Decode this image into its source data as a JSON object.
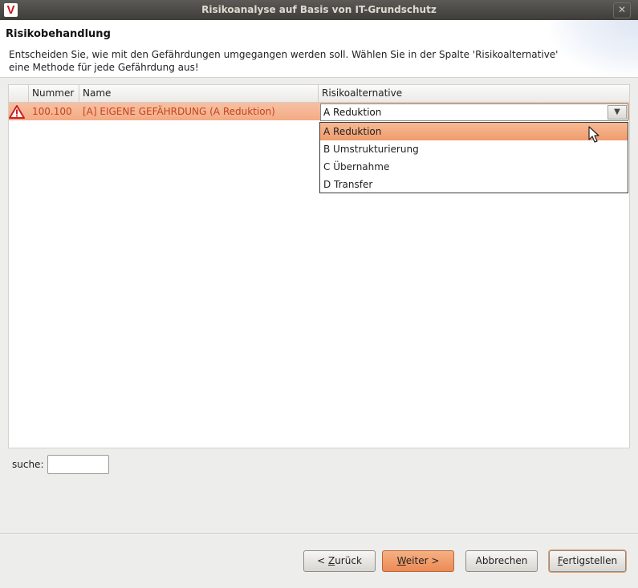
{
  "window": {
    "title": "Risikoanalyse auf Basis von IT-Grundschutz",
    "app_icon_letter": "V",
    "close_glyph": "✕"
  },
  "banner": {
    "title": "Risikobehandlung",
    "description_line1": "Entscheiden Sie, wie mit den Gefährdungen umgegangen werden soll. Wählen Sie in der Spalte 'Risikoalternative'",
    "description_line2": "eine Methode für jede Gefährdung aus!"
  },
  "table": {
    "columns": [
      "",
      "Nummer",
      "Name",
      "Risikoalternative"
    ],
    "rows": [
      {
        "icon": "warning-icon",
        "nummer": "100.100",
        "name": "[A] EIGENE GEFÄHRDUNG (A Reduktion)",
        "risikoalternative": "A Reduktion"
      }
    ]
  },
  "dropdown": {
    "options": [
      "A Reduktion",
      "B Umstrukturierung",
      "C Übernahme",
      "D Transfer"
    ],
    "selected_index": 0,
    "arrow_glyph": "▼"
  },
  "search": {
    "label": "suche:",
    "value": ""
  },
  "buttons": {
    "back_prefix": "< ",
    "back_mnemonic": "Z",
    "back_rest": "urück",
    "next_mnemonic": "W",
    "next_rest": "eiter >",
    "cancel": "Abbrechen",
    "finish_mnemonic": "F",
    "finish_rest": "ertigstellen"
  },
  "colors": {
    "selection": "#f3ab85",
    "row_text": "#c2451c",
    "primary_button": "#ec8a55",
    "warning_red": "#cc1f1f"
  }
}
